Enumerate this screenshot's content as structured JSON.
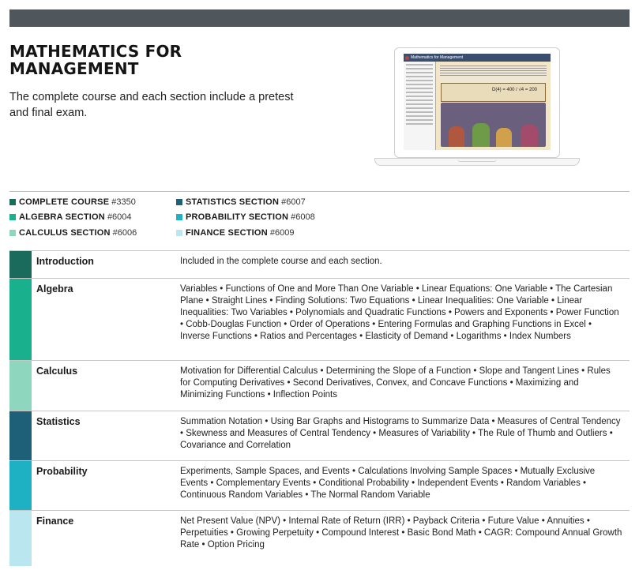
{
  "header": {
    "title": "MATHEMATICS FOR MANAGEMENT",
    "subtitle": "The complete course and each section include a pretest and final exam."
  },
  "laptop_screen": {
    "window_title": "Mathematics for Management",
    "formula": "D(4) = 400 / √4 = 200"
  },
  "legend": [
    {
      "name": "COMPLETE COURSE",
      "code": "#3350",
      "color": "#1a6b5c"
    },
    {
      "name": "ALGEBRA SECTION",
      "code": "#6004",
      "color": "#18b08d"
    },
    {
      "name": "CALCULUS SECTION",
      "code": "#6006",
      "color": "#8ed6bd"
    },
    {
      "name": "STATISTICS SECTION",
      "code": "#6007",
      "color": "#1f6079"
    },
    {
      "name": "PROBABILITY SECTION",
      "code": "#6008",
      "color": "#1eb0c3"
    },
    {
      "name": "FINANCE SECTION",
      "code": "#6009",
      "color": "#b9e6ef"
    }
  ],
  "sections": [
    {
      "name": "Introduction",
      "color": "#1a6b5c",
      "topics": "Included in the complete course and each section."
    },
    {
      "name": "Algebra",
      "color": "#18b08d",
      "topics": "Variables • Functions of One and More Than One Variable • Linear Equations: One Variable • The Cartesian Plane • Straight Lines • Finding Solutions: Two Equations • Linear Inequalities: One Variable • Linear Inequalities: Two Variables • Polynomials and Quadratic Functions • Powers and Exponents • Power Function • Cobb-Douglas Function • Order of Operations • Entering Formulas and Graphing Functions in Excel • Inverse Functions • Ratios and Percentages • Elasticity of Demand • Logarithms • Index Numbers"
    },
    {
      "name": "Calculus",
      "color": "#8ed6bd",
      "topics": "Motivation for Differential Calculus • Determining the Slope of a Function • Slope and Tangent Lines • Rules for Computing Derivatives • Second Derivatives, Convex, and Concave Functions • Maximizing and Minimizing Functions • Inflection Points"
    },
    {
      "name": "Statistics",
      "color": "#1f6079",
      "topics": "Summation Notation • Using Bar Graphs and Histograms to Summarize Data • Measures of Central Tendency • Skewness and Measures of Central Tendency • Measures of Variability • The Rule of Thumb and Outliers • Covariance and Correlation"
    },
    {
      "name": "Probability",
      "color": "#1eb0c3",
      "topics": "Experiments, Sample Spaces, and Events • Calculations Involving Sample Spaces • Mutually Exclusive Events • Complementary Events • Conditional Probability • Independent Events • Random Variables • Continuous Random Variables • The Normal Random Variable"
    },
    {
      "name": "Finance",
      "color": "#b9e6ef",
      "topics": "Net Present Value (NPV) • Internal Rate of Return (IRR) • Payback Criteria • Future Value • Annuities • Perpetuities • Growing Perpetuity • Compound Interest • Basic Bond Math • CAGR: Compound Annual Growth Rate • Option Pricing"
    }
  ]
}
